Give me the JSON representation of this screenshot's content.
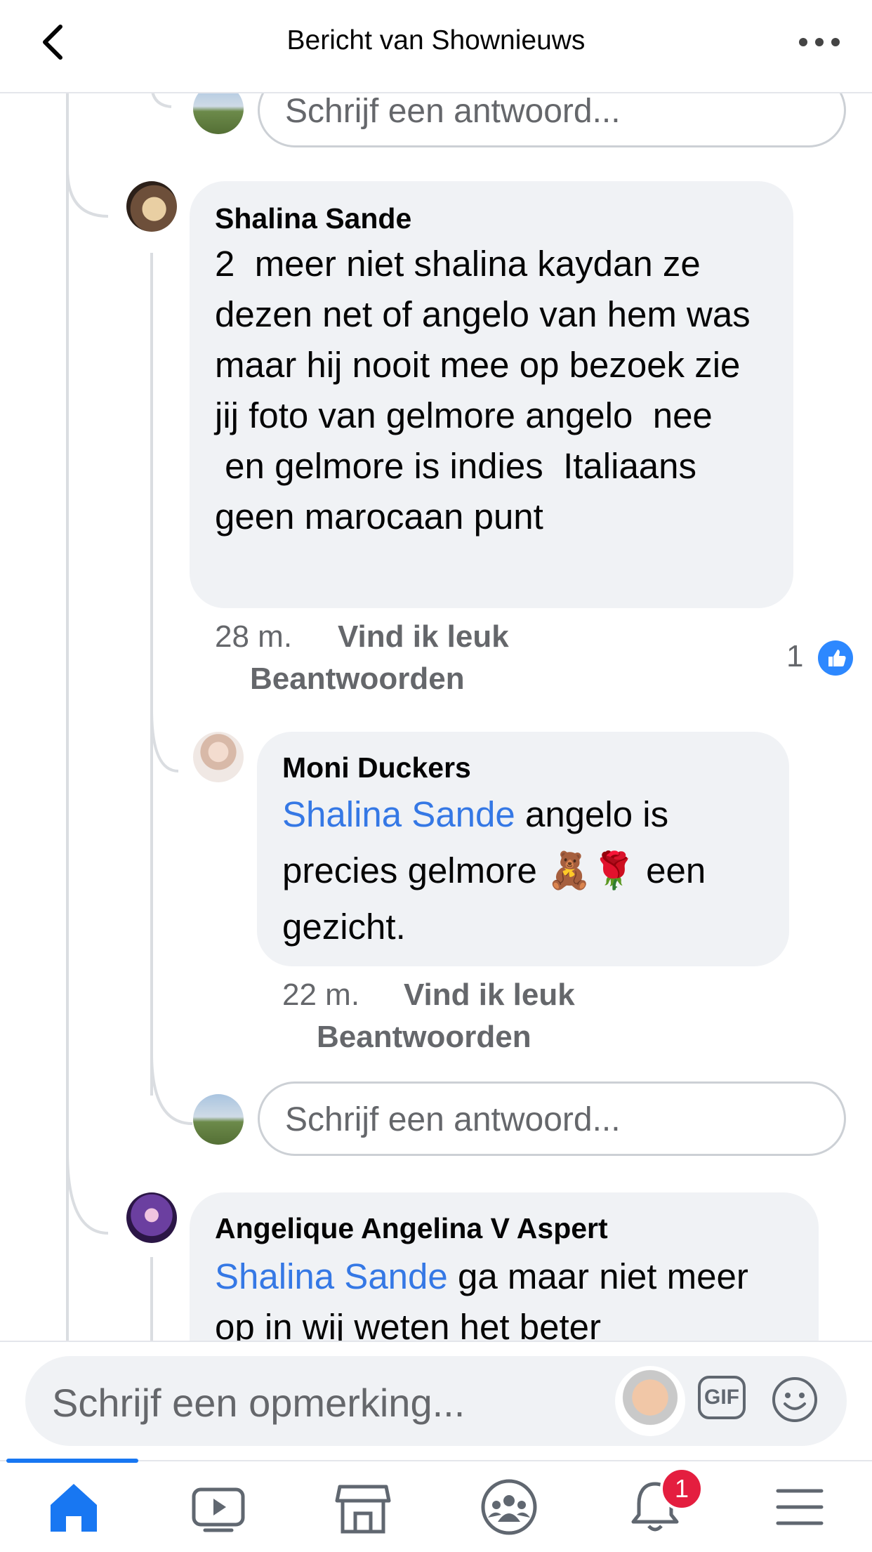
{
  "header": {
    "title": "Bericht van Shownieuws"
  },
  "reply_placeholder": "Schrijf een antwoord...",
  "comments": [
    {
      "author": "Shalina Sande",
      "text": "2  meer niet shalina kaydan ze dezen net of angelo van hem was maar hij nooit mee op bezoek zie jij foto van gelmore angelo  nee\n en gelmore is indies  Italiaans geen marocaan punt",
      "time": "28 m.",
      "like_label": "Vind ik leuk",
      "reply_label": "Beantwoorden",
      "like_count": "1"
    },
    {
      "author": "Moni Duckers",
      "mention": "Shalina Sande",
      "text": " angelo is precies gelmore 🧸🌹 een gezicht.",
      "time": "22 m.",
      "like_label": "Vind ik leuk",
      "reply_label": "Beantwoorden"
    },
    {
      "author": "Angelique Angelina V Aspert",
      "mention": "Shalina Sande",
      "text": " ga maar niet meer op in wij weten het beter"
    }
  ],
  "composer": {
    "placeholder": "Schrijf een opmerking...",
    "gif_label": "GIF"
  },
  "tabbar": {
    "notification_badge": "1",
    "tabs": [
      "home-icon",
      "video-icon",
      "marketplace-icon",
      "groups-icon",
      "notifications-icon",
      "menu-icon"
    ]
  },
  "colors": {
    "accent": "#1877f2",
    "mention": "#3578e5",
    "bubble": "#f0f2f5",
    "badge": "#e41e3f"
  }
}
